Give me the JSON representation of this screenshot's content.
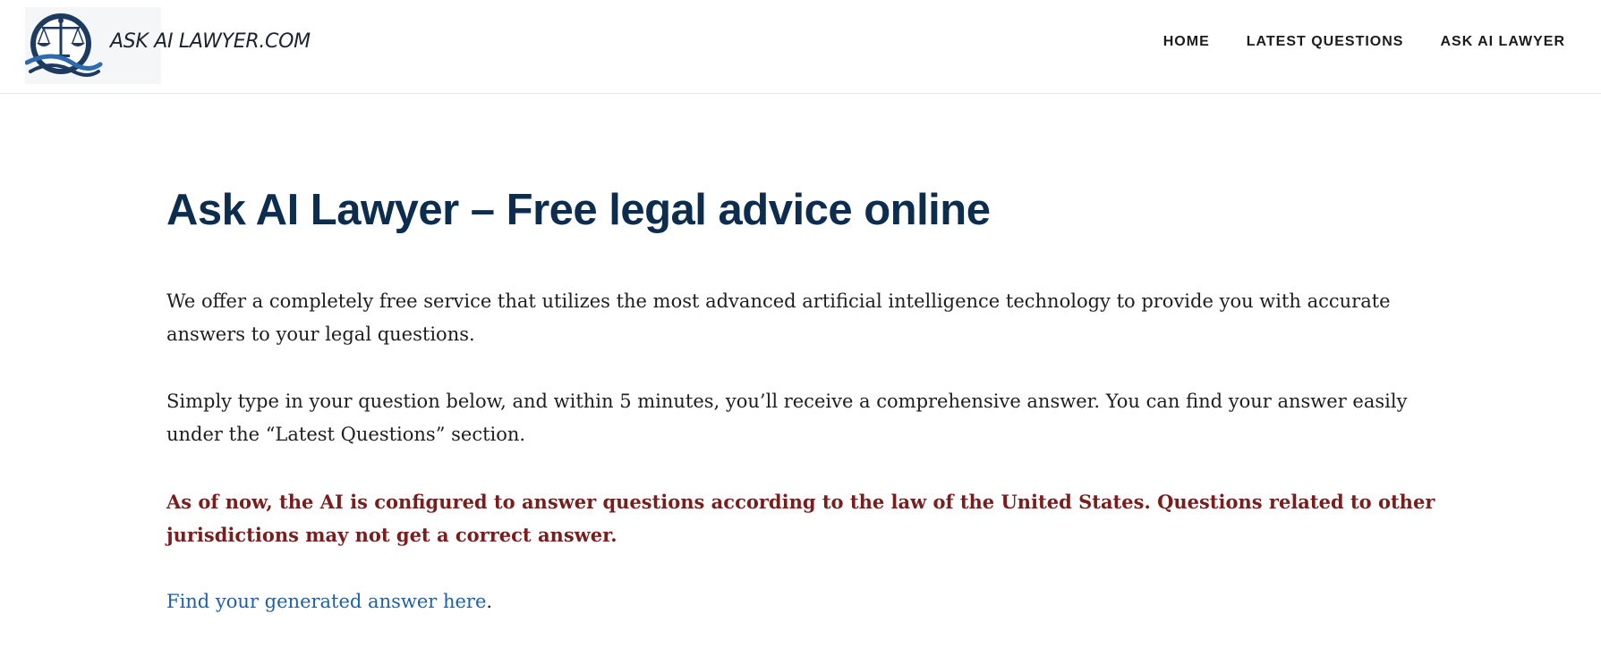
{
  "header": {
    "brand_name": "ASK AI LAWYER.COM",
    "logo_icon": "scales-of-justice-icon",
    "nav": [
      {
        "label": "HOME"
      },
      {
        "label": "LATEST QUESTIONS"
      },
      {
        "label": "ASK AI LAWYER"
      }
    ]
  },
  "main": {
    "title": "Ask AI Lawyer – Free legal advice online",
    "paragraph_1": "We offer a completely free service that utilizes the most advanced artificial intelligence technology to provide you with accurate answers to your legal questions.",
    "paragraph_2": "Simply type in your question below, and within 5 minutes, you’ll receive a comprehensive answer. You can find your answer easily under the “Latest Questions” section.",
    "warning": "As of now, the AI is configured to answer questions according to the law of the United States. Questions related to other jurisdictions may not get a correct answer.",
    "answer_link": "Find your generated answer here",
    "answer_link_suffix": "."
  },
  "colors": {
    "title": "#0c2d4e",
    "warning": "#7a1d1d",
    "link": "#1f5fa8",
    "logo_navy": "#1d3a5f",
    "logo_blue": "#2d6bb0"
  }
}
